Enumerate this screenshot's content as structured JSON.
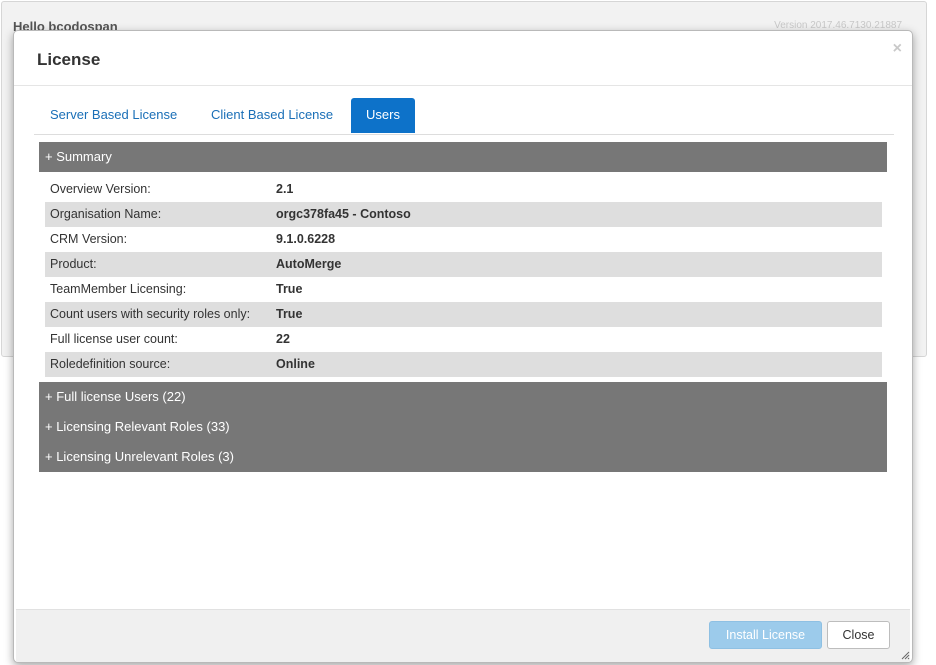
{
  "background": {
    "greeting": "Hello bcodospan",
    "version": "Version 2017.46.7130.21887"
  },
  "modal": {
    "title": "License",
    "close_glyph": "×",
    "tabs": [
      {
        "label": "Server Based License",
        "active": false
      },
      {
        "label": "Client Based License",
        "active": false
      },
      {
        "label": "Users",
        "active": true
      }
    ],
    "summary": {
      "header": "+ Summary",
      "rows": [
        {
          "key": "Overview Version:",
          "value": "2.1"
        },
        {
          "key": "Organisation Name:",
          "value": "orgc378fa45 - Contoso"
        },
        {
          "key": "CRM Version:",
          "value": "9.1.0.6228"
        },
        {
          "key": "Product:",
          "value": "AutoMerge"
        },
        {
          "key": "TeamMember Licensing:",
          "value": "True"
        },
        {
          "key": "Count users with security roles only:",
          "value": "True"
        },
        {
          "key": "Full license user count:",
          "value": "22"
        },
        {
          "key": "Roledefinition source:",
          "value": "Online"
        }
      ]
    },
    "sections": [
      {
        "label": "+ Full license Users (22)"
      },
      {
        "label": "+ Licensing Relevant Roles (33)"
      },
      {
        "label": "+ Licensing Unrelevant Roles (3)"
      }
    ],
    "footer": {
      "install_label": "Install License",
      "close_label": "Close"
    }
  },
  "colors": {
    "tab_active": "#0d72c9",
    "link": "#1a6fb7",
    "section_bar": "#777777",
    "row_alt": "#dedede",
    "install_disabled": "#9ccbeb"
  }
}
